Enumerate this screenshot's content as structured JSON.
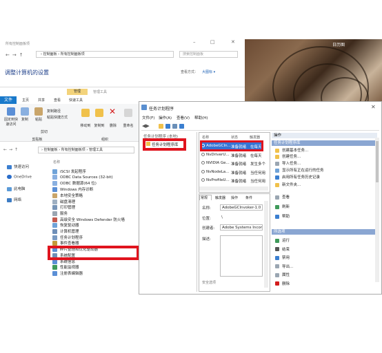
{
  "photo": {
    "label": "日历图"
  },
  "control_panel": {
    "title": "所有控制面板项",
    "breadcrumb": "› 控制面板 › 所有控制面板项",
    "search_placeholder": "搜索控制面板",
    "heading": "调整计算机的设置",
    "view_label": "查看方式：",
    "view_value": "大图标 ▾"
  },
  "explorer": {
    "context_tab": "管理",
    "title": "管理工具",
    "tabs": [
      "文件",
      "主页",
      "共享",
      "查看",
      "快速工具"
    ],
    "ribbon": {
      "pin": "固定到快速访问",
      "copy": "复制",
      "paste": "粘贴",
      "copy_path": "复制路径",
      "paste_shortcut": "粘贴快捷方式",
      "cut": "剪切",
      "clipboard": "剪贴板",
      "move_to": "移动到",
      "copy_to": "复制到",
      "delete": "删除",
      "rename": "重命名",
      "organize": "组织"
    },
    "breadcrumb": "› 控制面板 › 所有控制面板项 › 管理工具",
    "sidebar": [
      "快速访问",
      "OneDrive",
      "此电脑",
      "网络"
    ],
    "column_name": "名称",
    "items": [
      "iSCSI 发起程序",
      "ODBC Data Sources (32-bit)",
      "ODBC 数据源(64 位)",
      "Windows 内存诊断",
      "本地安全策略",
      "磁盘清理",
      "打印管理",
      "服务",
      "高级安全 Windows Defender 防火墙",
      "恢复驱动器",
      "计算机管理",
      "任务计划程序",
      "事件查看器",
      "碎片整理和优化驱动器",
      "系统配置",
      "系统信息",
      "性能监视器",
      "注册表编辑器"
    ]
  },
  "task_scheduler": {
    "title": "任务计划程序",
    "menu": [
      "文件(F)",
      "操作(A)",
      "查看(V)",
      "帮助(H)"
    ],
    "tree_root": "任务计划程序 (本地)",
    "tree_item": "任务计划程序库",
    "list_headers": [
      "名称",
      "状态",
      "触发器"
    ],
    "rows": [
      {
        "name": "AdobeGCIn...",
        "status": "准备就绪",
        "trigger": "在每天"
      },
      {
        "name": "NvDriverU...",
        "status": "准备就绪",
        "trigger": "在每天"
      },
      {
        "name": "NVIDIA Ge...",
        "status": "准备就绪",
        "trigger": "发生多个"
      },
      {
        "name": "NvNodeLa...",
        "status": "准备就绪",
        "trigger": "当任何用"
      },
      {
        "name": "NvProfileU...",
        "status": "准备就绪",
        "trigger": "当任何用"
      }
    ],
    "detail_tabs": [
      "常规",
      "触发器",
      "操作",
      "条件"
    ],
    "detail": {
      "name_label": "名称:",
      "name_value": "AdobeGCInvoker-1.0",
      "location_label": "位置:",
      "location_value": "\\",
      "author_label": "创建者:",
      "author_value": "Adobe Systems Incorpo",
      "desc_label": "描述:",
      "security_label": "安全选项"
    },
    "actions_header": "操作",
    "actions_library": "任务计划程序库",
    "actions": [
      "创建基本任务...",
      "创建任务...",
      "导入任务...",
      "显示所有正在运行的任务",
      "启用所有任务历史记录",
      "新文件夹...",
      "查看",
      "刷新",
      "帮助"
    ],
    "selected_header": "所选项",
    "selected_actions": [
      "运行",
      "结束",
      "禁用",
      "导出...",
      "属性",
      "删除"
    ]
  }
}
